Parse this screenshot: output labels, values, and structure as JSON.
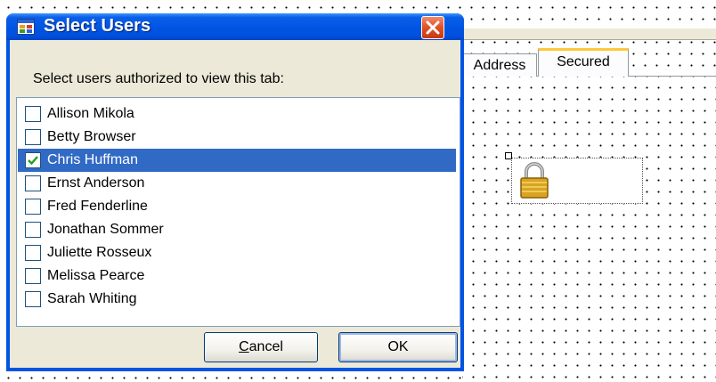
{
  "dialog": {
    "title": "Select Users",
    "prompt": "Select users authorized to view this tab:",
    "users": [
      {
        "name": "Allison Mikola",
        "checked": false,
        "selected": false
      },
      {
        "name": "Betty Browser",
        "checked": false,
        "selected": false
      },
      {
        "name": "Chris Huffman",
        "checked": true,
        "selected": true
      },
      {
        "name": "Ernst Anderson",
        "checked": false,
        "selected": false
      },
      {
        "name": "Fred Fenderline",
        "checked": false,
        "selected": false
      },
      {
        "name": "Jonathan Sommer",
        "checked": false,
        "selected": false
      },
      {
        "name": "Juliette Rosseux",
        "checked": false,
        "selected": false
      },
      {
        "name": "Melissa Pearce",
        "checked": false,
        "selected": false
      },
      {
        "name": "Sarah Whiting",
        "checked": false,
        "selected": false
      }
    ],
    "cancel_label_mnemonic": "C",
    "cancel_label_rest": "ancel",
    "ok_label": "OK"
  },
  "designer": {
    "tabs": [
      "Address",
      "Secured"
    ],
    "active_tab": "Secured"
  },
  "colors": {
    "titlebar": "#0054e3",
    "selection": "#316ac5",
    "close_button": "#e24f24",
    "tab_highlight": "#ffc83c"
  },
  "icons": {
    "title": "window-app-icon",
    "close": "close-icon",
    "check": "checkmark-icon",
    "lock": "padlock-icon"
  }
}
